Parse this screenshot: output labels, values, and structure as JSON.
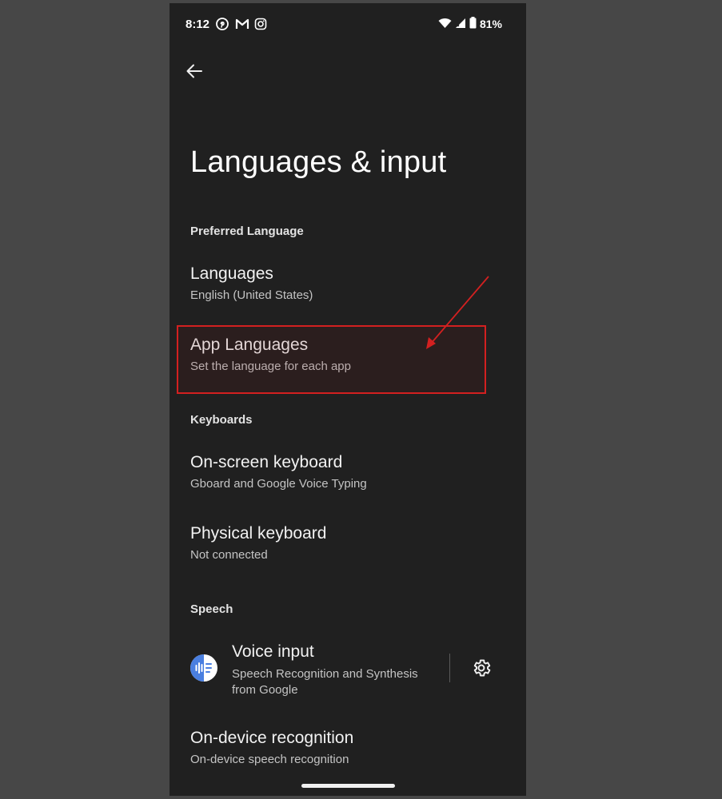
{
  "status_bar": {
    "time": "8:12",
    "battery": "81%",
    "notification_icons": [
      "pinterest-icon",
      "gmail-icon",
      "instagram-icon"
    ]
  },
  "page": {
    "title": "Languages & input"
  },
  "sections": {
    "preferred_language": {
      "header": "Preferred Language",
      "items": [
        {
          "title": "Languages",
          "summary": "English (United States)"
        },
        {
          "title": "App Languages",
          "summary": "Set the language for each app"
        }
      ]
    },
    "keyboards": {
      "header": "Keyboards",
      "items": [
        {
          "title": "On-screen keyboard",
          "summary": "Gboard and Google Voice Typing"
        },
        {
          "title": "Physical keyboard",
          "summary": "Not connected"
        }
      ]
    },
    "speech": {
      "header": "Speech",
      "voice_input": {
        "title": "Voice input",
        "summary": "Speech Recognition and Synthesis from Google"
      },
      "items": [
        {
          "title": "On-device recognition",
          "summary": "On-device speech recognition"
        }
      ]
    }
  },
  "colors": {
    "background": "#202020",
    "annotation": "#d32020",
    "voice_icon": "#4a7fe0"
  }
}
